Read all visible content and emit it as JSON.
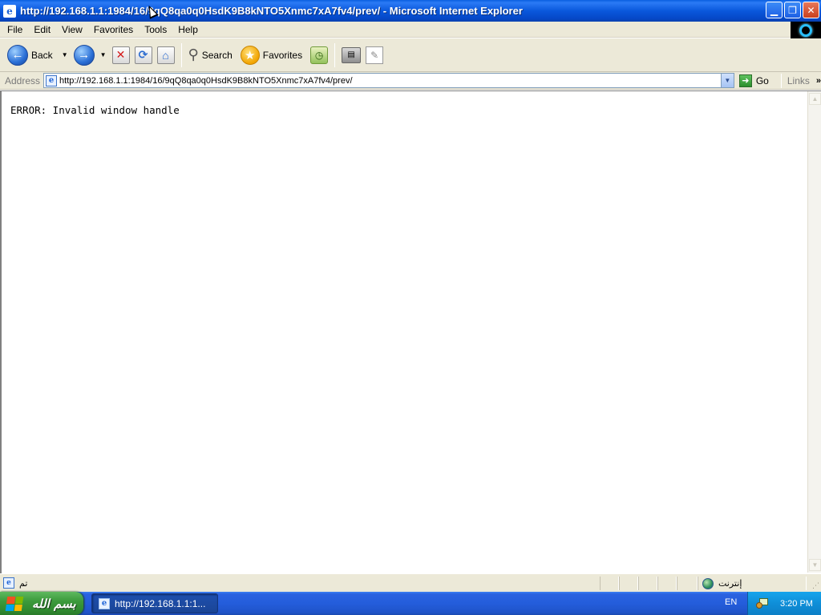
{
  "window": {
    "title": "http://192.168.1.1:1984/16/9qQ8qa0q0HsdK9B8kNTO5Xnmc7xA7fv4/prev/ - Microsoft Internet Explorer",
    "app_icon_glyph": "e",
    "minimize_glyph": "▁",
    "restore_glyph": "❐",
    "close_glyph": "✕"
  },
  "menu": {
    "items": [
      "File",
      "Edit",
      "View",
      "Favorites",
      "Tools",
      "Help"
    ]
  },
  "toolbar": {
    "back_label": "Back",
    "back_glyph": "←",
    "forward_glyph": "→",
    "dropdown_glyph": "▼",
    "stop_glyph": "✕",
    "refresh_glyph": "⟳",
    "home_glyph": "⌂",
    "search_glyph": "⚲",
    "search_label": "Search",
    "favorites_glyph": "★",
    "favorites_label": "Favorites",
    "history_glyph": "◷",
    "print_glyph": "▤",
    "edit_glyph": "✎"
  },
  "address": {
    "label": "Address",
    "url": "http://192.168.1.1:1984/16/9qQ8qa0q0HsdK9B8kNTO5Xnmc7xA7fv4/prev/",
    "dropdown_glyph": "▼",
    "go_glyph": "➜",
    "go_label": "Go",
    "links_label": "Links",
    "links_chevron": "»"
  },
  "content": {
    "error_text": "ERROR: Invalid window handle",
    "scroll_up_glyph": "▲",
    "scroll_down_glyph": "▼"
  },
  "status": {
    "icon_glyph": "e",
    "text": "تم",
    "zone_text": "إنترنت",
    "grip_glyph": "⋰"
  },
  "taskbar": {
    "start_label": "بسم الله",
    "task_label": "http://192.168.1.1:1...",
    "task_icon_glyph": "e",
    "language": "EN",
    "clock": "3:20 PM"
  },
  "colors": {
    "titlebar": "#0a58dc",
    "chrome": "#ece9d8",
    "taskbar": "#245ddb",
    "start": "#3c9a3c",
    "tray": "#0f8ed8"
  },
  "icons": [
    "app-icon",
    "back-icon",
    "forward-icon",
    "stop-icon",
    "refresh-icon",
    "home-icon",
    "search-icon",
    "favorites-icon",
    "history-icon",
    "print-icon",
    "edit-icon",
    "page-icon",
    "go-icon",
    "globe-icon",
    "windows-flag-icon",
    "network-tray-icon"
  ]
}
